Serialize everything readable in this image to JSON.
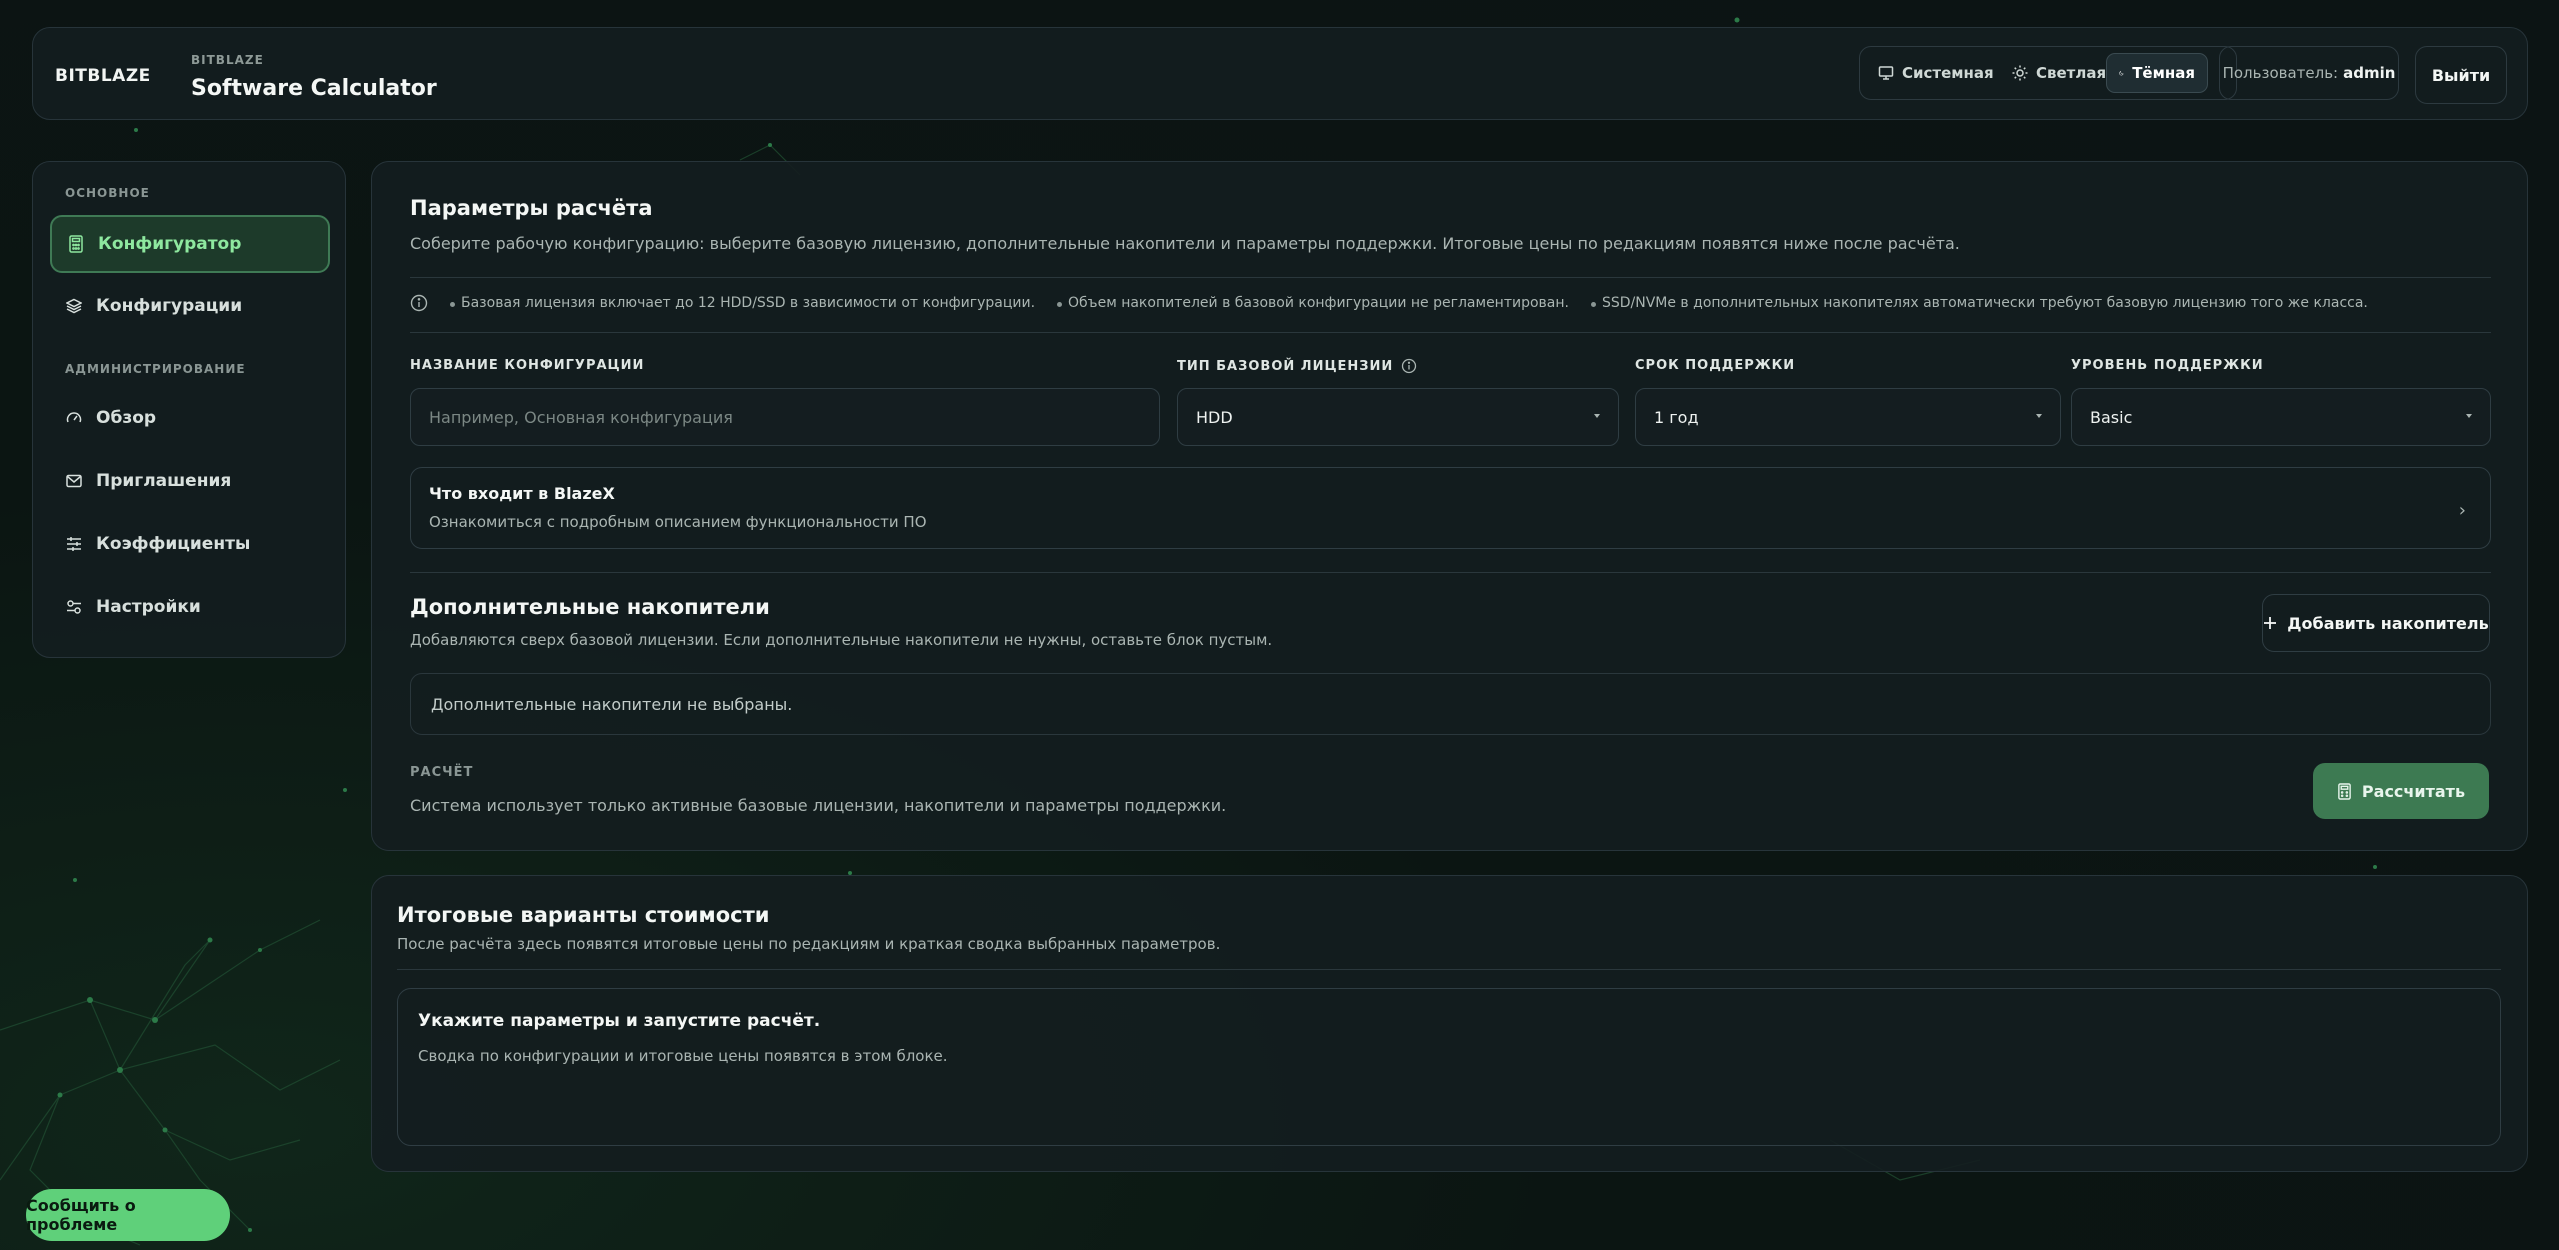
{
  "header": {
    "brand_logo": "BITBLAZE",
    "brand_small": "BITBLAZE",
    "app_title": "Software Calculator",
    "theme": {
      "system": "Системная",
      "light": "Светлая",
      "dark": "Тёмная",
      "active": "dark"
    },
    "user_label": "Пользователь:",
    "user_name": "admin",
    "logout": "Выйти"
  },
  "sidebar": {
    "section_main": "ОСНОВНОЕ",
    "section_admin": "АДМИНИСТРИРОВАНИЕ",
    "items": [
      {
        "label": "Конфигуратор",
        "icon": "calculator-icon",
        "active": true
      },
      {
        "label": "Конфигурации",
        "icon": "layers-icon",
        "active": false
      },
      {
        "label": "Обзор",
        "icon": "gauge-icon",
        "active": false
      },
      {
        "label": "Приглашения",
        "icon": "mail-icon",
        "active": false
      },
      {
        "label": "Коэффициенты",
        "icon": "sliders-icon",
        "active": false
      },
      {
        "label": "Настройки",
        "icon": "settings-toggle-icon",
        "active": false
      }
    ]
  },
  "params": {
    "title": "Параметры расчёта",
    "description": "Соберите рабочую конфигурацию: выберите базовую лицензию, дополнительные накопители и параметры поддержки. Итоговые цены по редакциям появятся ниже после расчёта.",
    "notes": [
      "Базовая лицензия включает до 12 HDD/SSD в зависимости от конфигурации.",
      "Объем накопителей в базовой конфигурации не регламентирован.",
      "SSD/NVMe в дополнительных накопителях автоматически требуют базовую лицензию того же класса."
    ],
    "fields": {
      "name_label": "НАЗВАНИЕ КОНФИГУРАЦИИ",
      "name_placeholder": "Например, Основная конфигурация",
      "license_label": "ТИП БАЗОВОЙ ЛИЦЕНЗИИ",
      "license_value": "HDD",
      "term_label": "СРОК ПОДДЕРЖКИ",
      "term_value": "1 год",
      "level_label": "УРОВЕНЬ ПОДДЕРЖКИ",
      "level_value": "Basic"
    },
    "blazex": {
      "title": "Что входит в BlazeX",
      "subtitle": "Ознакомиться с подробным описанием функциональности ПО"
    }
  },
  "storage": {
    "title": "Дополнительные накопители",
    "description": "Добавляются сверх базовой лицензии. Если дополнительные накопители не нужны, оставьте блок пустым.",
    "add_button": "Добавить накопитель",
    "empty_text": "Дополнительные накопители не выбраны."
  },
  "calc": {
    "label": "РАСЧЁТ",
    "description": "Система использует только активные базовые лицензии, накопители и параметры поддержки.",
    "button": "Рассчитать"
  },
  "results": {
    "title": "Итоговые варианты стоимости",
    "description": "После расчёта здесь появятся итоговые цены по редакциям и краткая сводка выбранных параметров.",
    "empty_title": "Укажите параметры и запустите расчёт.",
    "empty_text": "Сводка по конфигурации и итоговые цены появятся в этом блоке."
  },
  "report_button": "Сообщить о проблеме",
  "colors": {
    "accent": "#5fd07a",
    "accent_dark": "#3d7a52",
    "active_nav_text": "#8ee89f",
    "panel": "#141d1f",
    "border": "#27343a"
  }
}
